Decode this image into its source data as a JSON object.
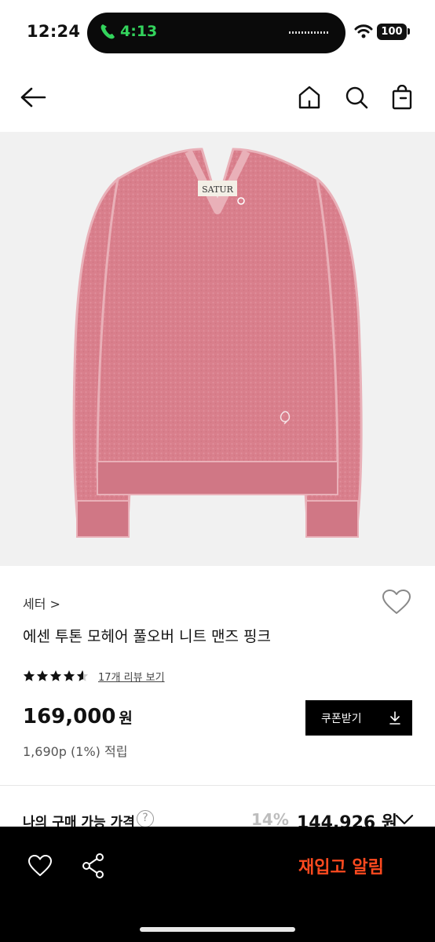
{
  "status_bar": {
    "time": "12:24",
    "call_time": "4:13",
    "battery": "100"
  },
  "header": {
    "back_icon": "arrow-left-icon",
    "home_icon": "home-icon",
    "search_icon": "search-icon",
    "bag_icon": "shopping-bag-icon"
  },
  "product": {
    "label_text": "SATUR",
    "category": "세터 >",
    "title": "에센 투톤 모헤어 풀오버 니트 맨즈 핑크",
    "rating": 4.5,
    "review_link": "17개 리뷰 보기",
    "price": "169,000",
    "price_unit": "원",
    "points": "1,690p (1%) 적립",
    "coupon_button": "쿠폰받기",
    "my_price_label": "나의 구매 가능 가격",
    "help_symbol": "?",
    "discount": "14%",
    "my_price": "144,926 원"
  },
  "bottom_bar": {
    "restock_button": "재입고 알림"
  },
  "colors": {
    "sweater": "#d97f8c",
    "accent": "#ff4a1f",
    "call_green": "#33d35c"
  }
}
